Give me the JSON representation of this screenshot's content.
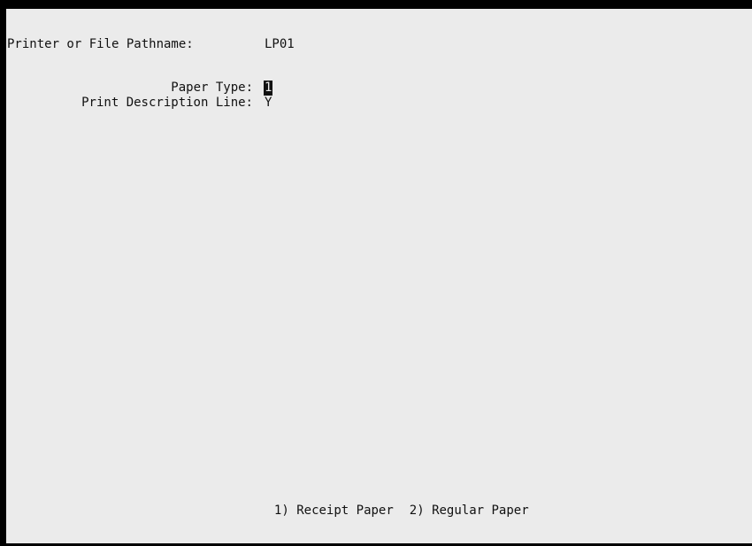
{
  "fields": {
    "printer": {
      "label": "Printer or File Pathname:",
      "value": "LP01"
    },
    "paper_type": {
      "label": "Paper Type:",
      "value": "1"
    },
    "print_description": {
      "label": "Print Description Line:",
      "value": "Y"
    }
  },
  "options": {
    "receipt": "1) Receipt Paper",
    "regular": "2) Regular Paper"
  }
}
